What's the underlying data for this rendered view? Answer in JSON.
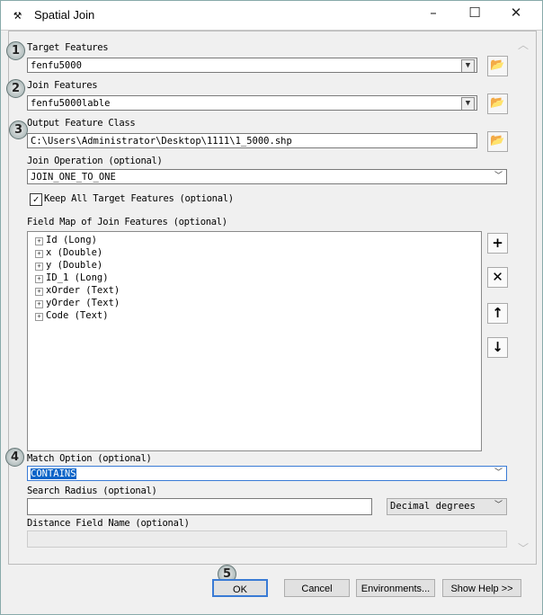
{
  "window": {
    "title": "Spatial Join",
    "icon": "hammer-icon"
  },
  "params": {
    "target_label": "Target Features",
    "target_value": "fenfu5000",
    "join_label": "Join Features",
    "join_value": "fenfu5000lable",
    "output_label": "Output Feature Class",
    "output_value": "C:\\Users\\Administrator\\Desktop\\1111\\1_5000.shp",
    "operation_label": "Join Operation (optional)",
    "operation_value": "JOIN_ONE_TO_ONE",
    "keep_label": "Keep All Target Features (optional)",
    "keep_checked": true,
    "fieldmap_label": "Field Map of Join Features (optional)",
    "fields": [
      "Id (Long)",
      "x (Double)",
      "y (Double)",
      "ID_1 (Long)",
      "xOrder (Text)",
      "yOrder (Text)",
      "Code (Text)"
    ],
    "match_label": "Match Option (optional)",
    "match_value": "CONTAINS",
    "radius_label": "Search Radius (optional)",
    "radius_value": "",
    "radius_units": "Decimal degrees",
    "distance_label": "Distance Field Name (optional)",
    "distance_value": ""
  },
  "badges": [
    "1",
    "2",
    "3",
    "4",
    "5"
  ],
  "buttons": {
    "ok": "OK",
    "cancel": "Cancel",
    "environments": "Environments...",
    "help": "Show Help >>"
  }
}
